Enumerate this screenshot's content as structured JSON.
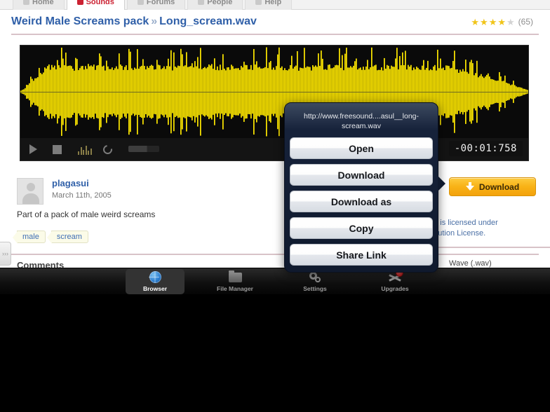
{
  "nav": {
    "tabs": [
      {
        "label": "Home",
        "icon": "home-icon",
        "active": false
      },
      {
        "label": "Sounds",
        "icon": "sounds-icon",
        "active": true
      },
      {
        "label": "Forums",
        "icon": "forums-icon",
        "active": false
      },
      {
        "label": "People",
        "icon": "people-icon",
        "active": false
      },
      {
        "label": "Help",
        "icon": "help-icon",
        "active": false
      }
    ]
  },
  "header": {
    "pack_title": "Weird Male Screams pack",
    "separator": "»",
    "file_title": "Long_scream.wav",
    "rating": {
      "filled": 4,
      "total": 5,
      "count": "(65)"
    }
  },
  "player": {
    "time_display": "-00:01:758",
    "controls": [
      {
        "name": "play-button",
        "label": "Play"
      },
      {
        "name": "stop-button",
        "label": "Stop"
      },
      {
        "name": "spectrogram-button",
        "label": "Spectrogram"
      },
      {
        "name": "loop-button",
        "label": "Loop"
      },
      {
        "name": "volume-slider",
        "label": "Volume"
      }
    ],
    "waveform_color": "#ffe800",
    "background_color": "#0a0a0a"
  },
  "sound": {
    "author": "plagasui",
    "date": "March 11th, 2005",
    "description": "Part of a pack of male weird screams",
    "tags": [
      "male",
      "scream"
    ],
    "comments_heading": "Comments",
    "download_label": "Download",
    "license_line1": "is work is licensed under",
    "license_line2": "e Attribution License.",
    "format": "Wave (.wav)"
  },
  "context_menu": {
    "url": "http://www.freesound....asul__long-scream.wav",
    "items": [
      {
        "label": "Open"
      },
      {
        "label": "Download"
      },
      {
        "label": "Download as"
      },
      {
        "label": "Copy"
      },
      {
        "label": "Share Link"
      }
    ]
  },
  "tabbar": {
    "items": [
      {
        "label": "Browser",
        "icon": "globe-icon",
        "selected": true
      },
      {
        "label": "File Manager",
        "icon": "folder-icon",
        "selected": false
      },
      {
        "label": "Settings",
        "icon": "gears-icon",
        "selected": false
      },
      {
        "label": "Upgrades",
        "icon": "star-icon",
        "selected": false,
        "badge": true
      }
    ]
  },
  "edge_handle": {
    "glyph": "›››"
  }
}
